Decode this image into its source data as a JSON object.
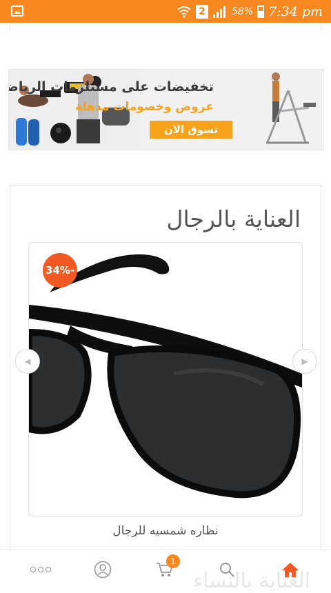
{
  "status_bar": {
    "sim_slot": "2",
    "battery_percent": "58%",
    "time": "7:34 pm",
    "color": "#f7871f"
  },
  "banner": {
    "title": "تخفيضات على مستلزمات الرياضة",
    "subtitle": "عروض وخصومات مذهلة",
    "button": "تسوق الان"
  },
  "section": {
    "title": "العناية بالرجال"
  },
  "product": {
    "discount": "34%-",
    "name": "نظاره شمسيه للرجال"
  },
  "bottom_nav": {
    "items": [
      "more-icon",
      "account-icon",
      "cart-icon",
      "search-icon",
      "home-icon"
    ],
    "cart_count": "1",
    "active_color": "#f15a22",
    "next_section_peek": "العناية بالنساء"
  }
}
